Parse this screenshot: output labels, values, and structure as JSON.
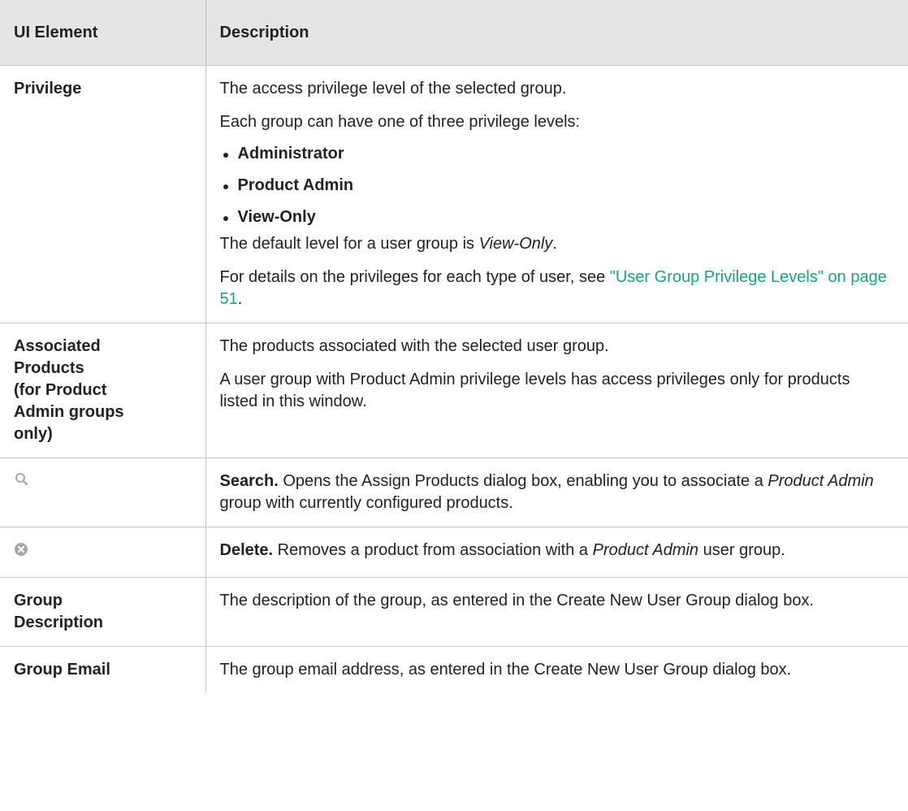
{
  "header": {
    "col1": "UI Element",
    "col2": "Description"
  },
  "rows": {
    "privilege": {
      "name": "Privilege",
      "p1": "The access privilege level of the selected group.",
      "p2": "Each group can have one of three privilege levels:",
      "levels": [
        "Administrator",
        "Product Admin",
        "View-Only"
      ],
      "default_prefix": "The default level for a user group is ",
      "default_value": "View-Only",
      "default_suffix": ".",
      "details_prefix": "For details on the privileges for each type of user, see ",
      "details_link": "\"User Group Privilege Levels\" on page 51",
      "details_suffix": "."
    },
    "associated_products": {
      "name_line1": "Associated",
      "name_line2": "Products",
      "name_line3": "(for Product",
      "name_line4": "Admin groups",
      "name_line5": "only)",
      "p1": "The products associated with the selected user group.",
      "p2": "A user group with Product Admin privilege levels has access privileges only for products listed in this window."
    },
    "search": {
      "icon": "search-icon",
      "label": "Search.",
      "text1": " Opens the Assign Products dialog box, enabling you to associate a ",
      "emph": "Product Admin",
      "text2": " group with currently configured products."
    },
    "delete": {
      "icon": "delete-icon",
      "label": "Delete.",
      "text1": " Removes a product from association with a ",
      "emph": "Product Admin",
      "text2": " user group."
    },
    "group_description": {
      "name_line1": "Group",
      "name_line2": "Description",
      "text": "The description of the group, as entered in the Create New User Group dialog box."
    },
    "group_email": {
      "name": "Group Email",
      "text": "The group email address, as entered in the Create New User Group dialog box."
    }
  },
  "colors": {
    "header_bg": "#e5e5e5",
    "border": "#c6c6c6",
    "link": "#14a67a",
    "icon_gray": "#a8a8a8"
  }
}
